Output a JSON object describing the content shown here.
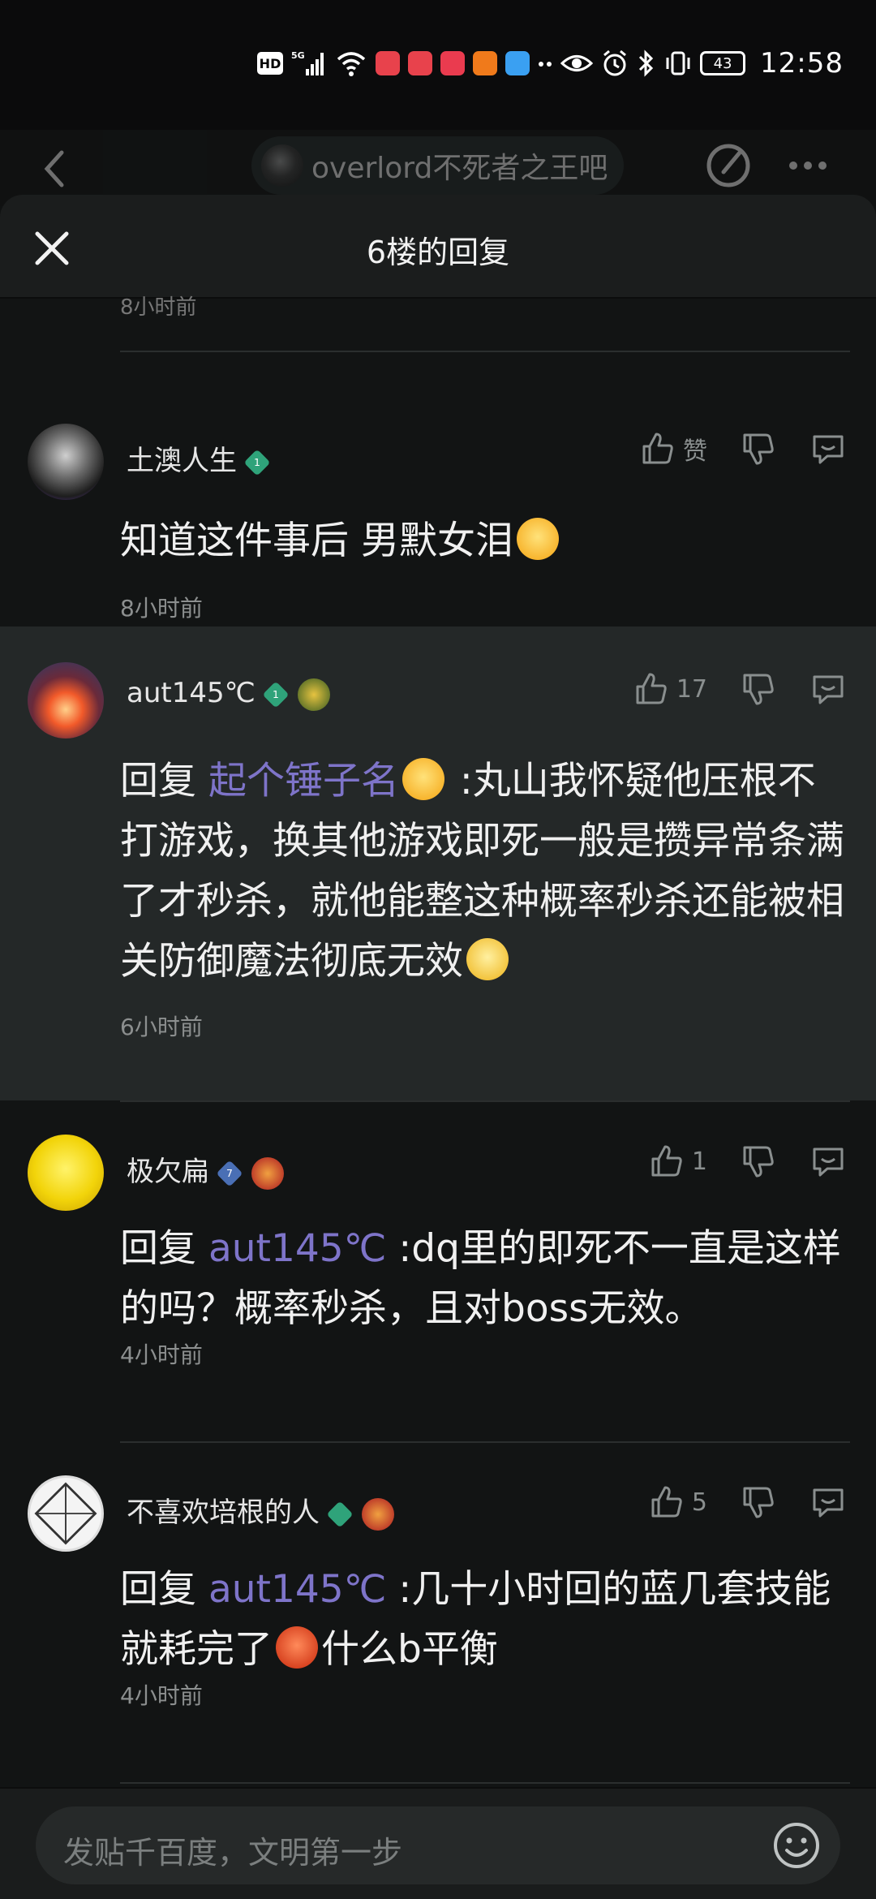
{
  "status_bar": {
    "hd": "HD",
    "signal": "5G",
    "battery": "43",
    "time": "12:58"
  },
  "page_header": {
    "forum_name": "overlord不死者之王吧"
  },
  "sheet": {
    "title": "6楼的回复",
    "peek_time": "8小时前"
  },
  "comments": [
    {
      "user": "土澳人生",
      "level": "1",
      "level_color": "#2fa37a",
      "like_label": "赞",
      "text": "知道这件事后 男默女泪",
      "time": "8小时前"
    },
    {
      "user": "aut145℃",
      "level": "1",
      "level_color": "#2fa37a",
      "like_label": "17",
      "reply_prefix": "回复",
      "mention": "起个锤子名",
      "text": " :丸山我怀疑他压根不打游戏，换其他游戏即死一般是攒异常条满了才秒杀，就他能整这种概率秒杀还能被相关防御魔法彻底无效",
      "time": "6小时前"
    },
    {
      "user": "极欠扁",
      "level": "7",
      "level_color": "#4a6fb5",
      "like_label": "1",
      "reply_prefix": "回复",
      "mention": "aut145℃",
      "text": " :dq里的即死不一直是这样的吗？概率秒杀，且对boss无效。",
      "time": "4小时前"
    },
    {
      "user": "不喜欢培根的人",
      "level": "",
      "level_color": "#2fa37a",
      "like_label": "5",
      "reply_prefix": "回复",
      "mention": "aut145℃",
      "text_a": " :几十小时回的蓝几套技能就耗完了",
      "text_b": "什么b平衡",
      "time": "4小时前"
    }
  ],
  "input": {
    "placeholder": "发贴千百度，文明第一步"
  }
}
